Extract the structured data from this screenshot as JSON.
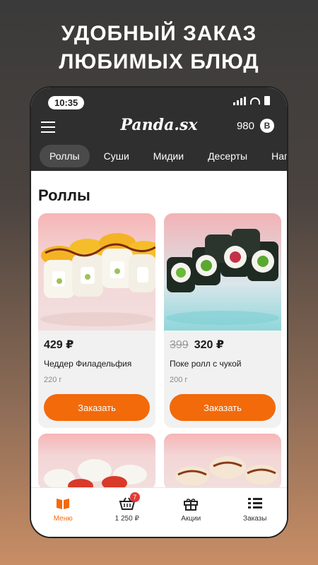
{
  "promo": {
    "line1": "УДОБНЫЙ ЗАКАЗ",
    "line2": "ЛЮБИМЫХ БЛЮД"
  },
  "status_bar": {
    "time": "10:35"
  },
  "header": {
    "logo": "Panda.sx",
    "balance": "980",
    "coin_glyph": "B"
  },
  "categories": [
    "Роллы",
    "Суши",
    "Мидии",
    "Десерты",
    "Напитк"
  ],
  "section": {
    "title": "Роллы"
  },
  "products": [
    {
      "price": "429 ₽",
      "old_price": "",
      "name": "Чеддер Филадельфия",
      "weight": "220 г",
      "button": "Заказать"
    },
    {
      "price": "320 ₽",
      "old_price": "399",
      "name": "Поке ролл с чукой",
      "weight": "200 г",
      "button": "Заказать"
    }
  ],
  "tabbar": {
    "menu": "Меню",
    "cart": "1 250 ₽",
    "cart_badge": "7",
    "promos": "Акции",
    "orders": "Заказы"
  },
  "colors": {
    "accent": "#f26a0a",
    "topbar": "#2f2f2f",
    "badge": "#e53935"
  }
}
